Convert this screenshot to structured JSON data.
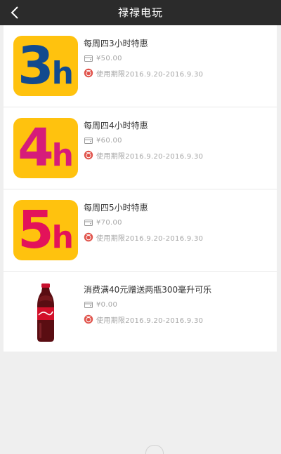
{
  "header": {
    "title": "禄禄电玩",
    "back_icon": "back-arrow-icon"
  },
  "colors": {
    "header_bg": "#2b2b2b",
    "tile_bg": "#ffc20e",
    "badge_red": "#e0524a"
  },
  "coupons": [
    {
      "thumb_main": "3",
      "thumb_unit": "h",
      "thumb_color": "#124a8e",
      "name": "每周四3小时特惠",
      "price": "¥50.00",
      "validity": "使用期限2016.9.20-2016.9.30"
    },
    {
      "thumb_main": "4",
      "thumb_unit": "h",
      "thumb_color": "#d61c7a",
      "name": "每周四4小时特惠",
      "price": "¥60.00",
      "validity": "使用期限2016.9.20-2016.9.30"
    },
    {
      "thumb_main": "5",
      "thumb_unit": "h",
      "thumb_color": "#e3125a",
      "name": "每周四5小时特惠",
      "price": "¥70.00",
      "validity": "使用期限2016.9.20-2016.9.30"
    },
    {
      "thumb_image": "cola-bottle",
      "name": "消费满40元赠送两瓶300毫升可乐",
      "price": "¥0.00",
      "validity": "使用期限2016.9.20-2016.9.30"
    }
  ]
}
